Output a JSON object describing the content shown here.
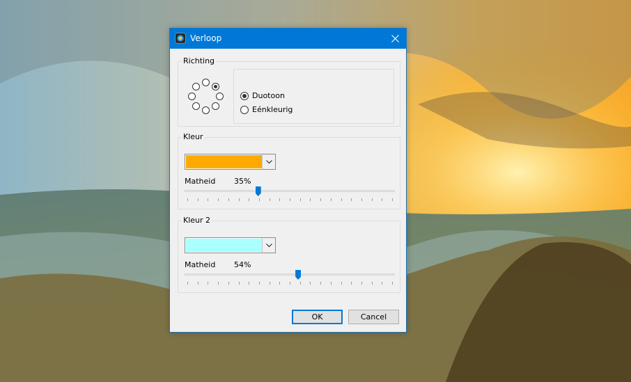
{
  "window": {
    "title": "Verloop",
    "icon": "app-icon",
    "close_icon": "close-icon"
  },
  "direction": {
    "legend": "Richting",
    "selected_index": 1,
    "options": [
      "Duotoon",
      "Eénkleurig"
    ],
    "selected_option": 0
  },
  "color1": {
    "legend": "Kleur",
    "swatch": "#ffaa00",
    "opacity_label": "Matheid",
    "opacity_value": "35%",
    "opacity_fraction": 0.35
  },
  "color2": {
    "legend": "Kleur 2",
    "swatch": "#aaffff",
    "opacity_label": "Matheid",
    "opacity_value": "54%",
    "opacity_fraction": 0.54
  },
  "buttons": {
    "ok": "OK",
    "cancel": "Cancel"
  },
  "colors": {
    "titlebar": "#0078d7",
    "dialog_bg": "#f0f0f0",
    "slider_thumb": "#0078d7"
  }
}
